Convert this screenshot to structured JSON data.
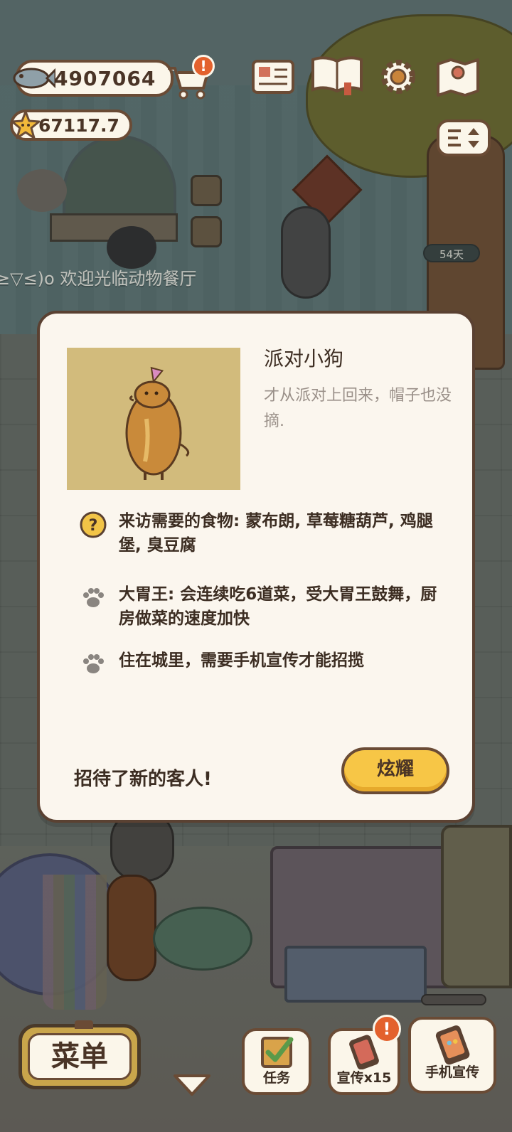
{
  "hud": {
    "fish_count": "4907064",
    "star_count": "67117.7",
    "cart_alert": "!"
  },
  "scene": {
    "welcome_text": "≥▽≤)o 欢迎光临动物餐厅",
    "days_badge": "54天"
  },
  "dialog": {
    "name": "派对小狗",
    "description": "才从派对上回来，帽子也没摘.",
    "info": [
      {
        "icon": "question-icon",
        "text": "来访需要的食物: 蒙布朗, 草莓糖葫芦, 鸡腿堡, 臭豆腐"
      },
      {
        "icon": "paw-icon",
        "text": "大胃王: 会连续吃6道菜，受大胃王鼓舞，厨房做菜的速度加快"
      },
      {
        "icon": "paw-icon",
        "text": "住在城里，需要手机宣传才能招揽"
      }
    ],
    "greeting": "招待了新的客人!",
    "show_button": "炫耀"
  },
  "bottom_bar": {
    "menu": "菜单",
    "task": "任务",
    "promo": "宣传x15",
    "promo_alert": "!",
    "phone_promo": "手机宣传"
  },
  "colors": {
    "panel": "#fbf6ee",
    "border": "#5a4132",
    "accent_yellow": "#f7c646",
    "alert": "#e3612d"
  }
}
